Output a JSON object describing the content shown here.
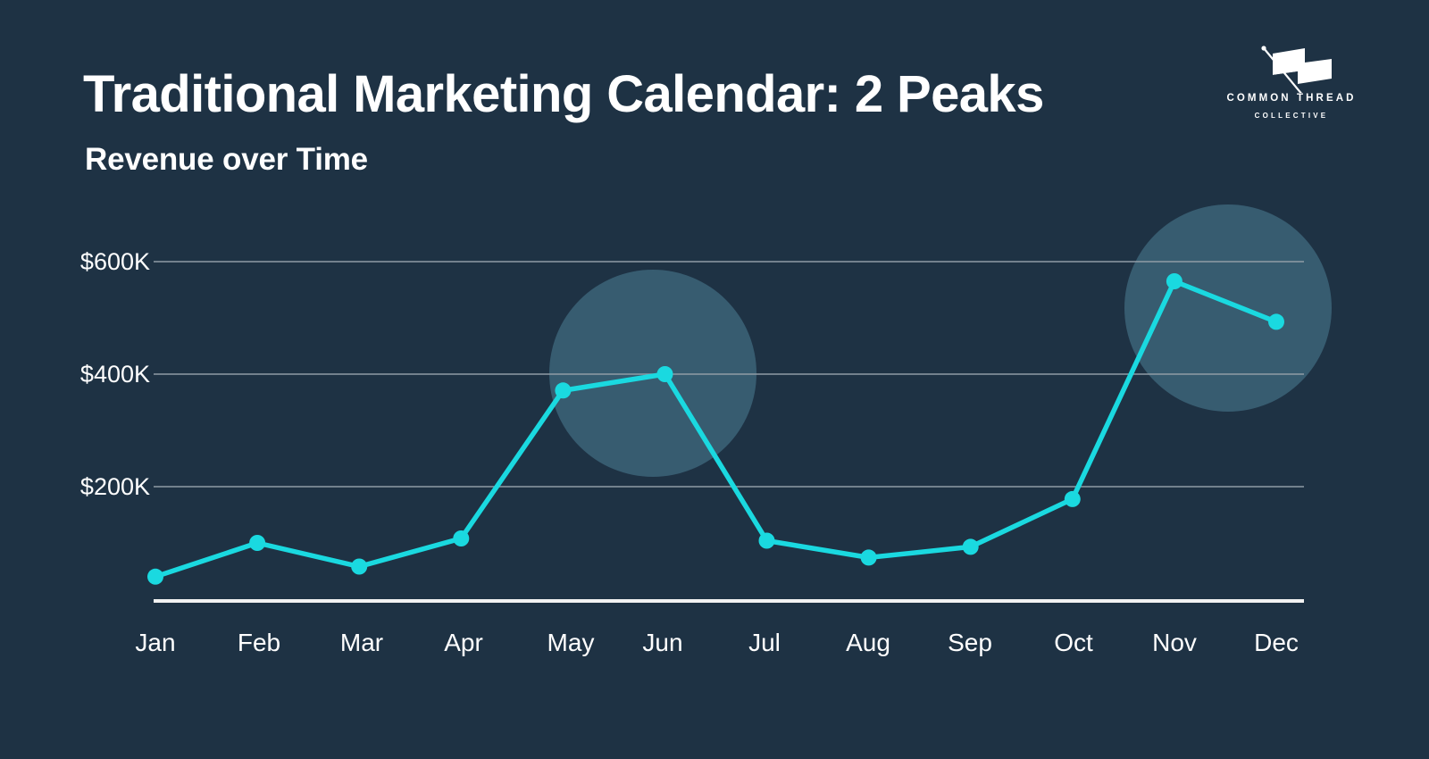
{
  "header": {
    "title": "Traditional Marketing Calendar: 2 Peaks",
    "subtitle": "Revenue over Time"
  },
  "logo": {
    "name": "COMMON THREAD",
    "sub": "COLLECTIVE",
    "mark": "flag-needle-icon"
  },
  "colors": {
    "background": "#1e3244",
    "line": "#1ad9e0",
    "marker": "#1ad9e0",
    "gridline": "#8f9ba5",
    "axis": "#f2f2f2",
    "highlight": "#3a6074",
    "text": "#ffffff"
  },
  "chart_data": {
    "type": "line",
    "title": "Traditional Marketing Calendar: 2 Peaks",
    "subtitle": "Revenue over Time",
    "xlabel": "",
    "ylabel": "",
    "categories": [
      "Jan",
      "Feb",
      "Mar",
      "Apr",
      "May",
      "Jun",
      "Jul",
      "Aug",
      "Sep",
      "Oct",
      "Nov",
      "Dec"
    ],
    "series": [
      {
        "name": "Revenue",
        "values": [
          40000,
          100000,
          58000,
          108000,
          371000,
          400000,
          104000,
          74000,
          93000,
          178000,
          565000,
          493000
        ]
      }
    ],
    "ylim": [
      0,
      680000
    ],
    "ytick_values": [
      200000,
      400000,
      600000
    ],
    "ytick_labels": [
      "$200K",
      "$400K",
      "$600K"
    ],
    "grid": true,
    "legend": false,
    "annotations": [
      {
        "label": "peak-1-highlight",
        "center_category": "Jun",
        "spans": [
          "May",
          "Jun"
        ]
      },
      {
        "label": "peak-2-highlight",
        "center_category": "Nov",
        "spans": [
          "Nov",
          "Dec"
        ]
      }
    ]
  }
}
